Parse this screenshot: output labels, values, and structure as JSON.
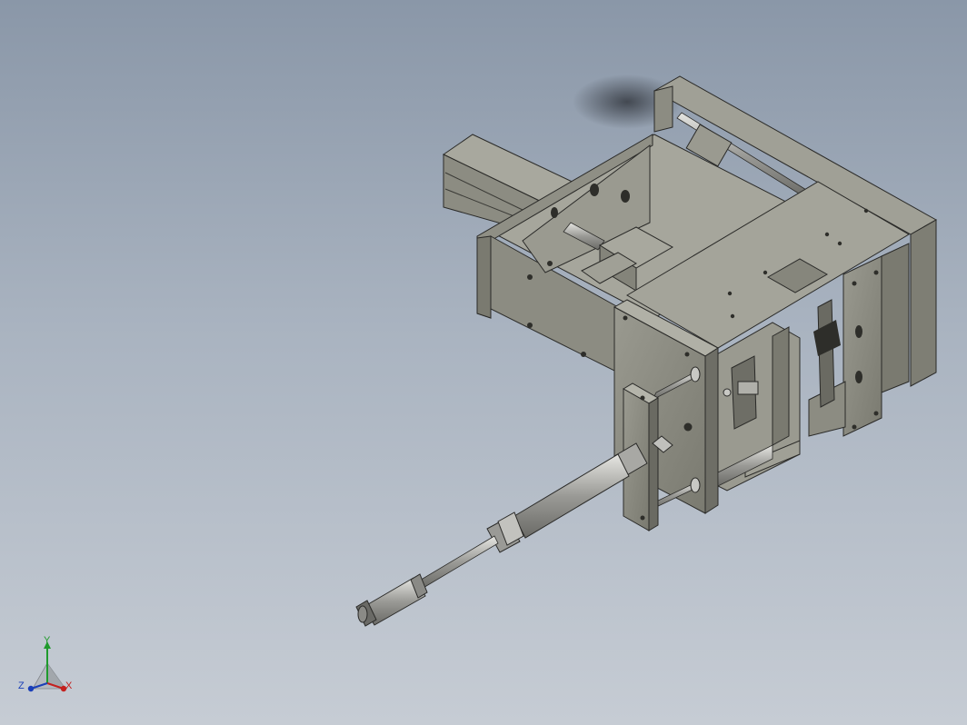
{
  "viewport": {
    "background_top": "#8a97a8",
    "background_bottom": "#c6ccd4"
  },
  "model": {
    "icon": "cad-assembly-model",
    "part_color": "#8c8c82",
    "metal_color": "#b8b8b4"
  },
  "triad": {
    "icon": "axis-triad-icon",
    "x_label": "X",
    "y_label": "Y",
    "z_label": "Z",
    "x_color": "#c4201e",
    "y_color": "#1f9a2c",
    "z_color": "#1a3fb8"
  }
}
